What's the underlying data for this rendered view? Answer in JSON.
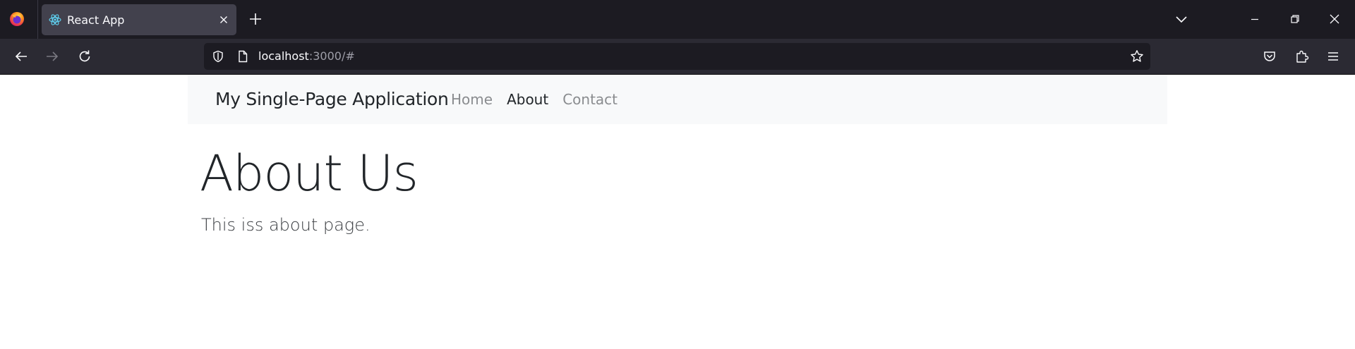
{
  "browser": {
    "tab": {
      "title": "React App"
    },
    "url": {
      "host": "localhost",
      "rest": ":3000/#"
    }
  },
  "site": {
    "brand": "My Single-Page Application",
    "nav": [
      {
        "label": "Home",
        "active": false
      },
      {
        "label": "About",
        "active": true
      },
      {
        "label": "Contact",
        "active": false
      }
    ]
  },
  "main": {
    "title": "About Us",
    "body": "This iss about page."
  },
  "colors": {
    "chrome_dark": "#1c1b22",
    "toolbar": "#2b2a33",
    "tab_active": "#42414d",
    "navbar_bg": "#f8f9fa",
    "text_dark": "#212529",
    "nav_muted": "#8a8c8f"
  }
}
